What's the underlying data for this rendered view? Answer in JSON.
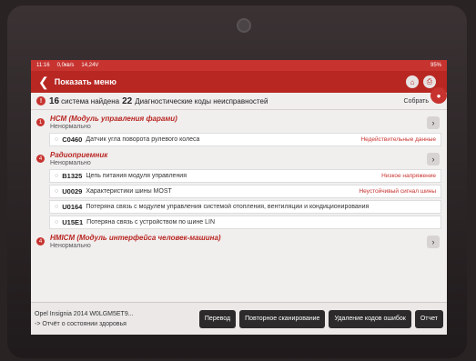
{
  "statusbar": {
    "time": "11:16",
    "speed": "0,0кв/s",
    "voltage": "14,24V",
    "battery": "95%"
  },
  "header": {
    "title": "Показать меню"
  },
  "summary": {
    "systems_count": "16",
    "systems_label": "система найдена",
    "dtc_count": "22",
    "dtc_label": "Диагностические коды неисправностей",
    "collect_label": "Собрать"
  },
  "systems": [
    {
      "badge": "1",
      "name": "HCM (Модуль управления фарами)",
      "status": "Ненормально",
      "codes": [
        {
          "id": "C0460",
          "desc": "Датчик угла поворота рулевого колеса",
          "state": "Недействительные данные"
        }
      ]
    },
    {
      "badge": "4",
      "name": "Радиоприемник",
      "status": "Ненормально",
      "codes": [
        {
          "id": "B1325",
          "desc": "Цепь питания модуля управления",
          "state": "Низкое напряжение"
        },
        {
          "id": "U0029",
          "desc": "Характеристики шины MOST",
          "state": "Неустойчивый сигнал шины"
        },
        {
          "id": "U0164",
          "desc": "Потеряна связь с модулем управления системой отопления, вентиляции и кондиционирования",
          "state": ""
        },
        {
          "id": "U15E1",
          "desc": "Потеряна связь с устройством по шине LIN",
          "state": ""
        }
      ]
    },
    {
      "badge": "4",
      "name": "HMICM (Модуль интерфейса человек-машина)",
      "status": "Ненормально",
      "codes": []
    }
  ],
  "bottom": {
    "vehicle": "Opel  Insignia 2014  W0LGM5ET9...",
    "report_link": "-> Отчёт о состоянии здоровья",
    "btn_translate": "Перевод",
    "btn_rescan": "Повторное сканирование",
    "btn_clear": "Удаление кодов ошибок",
    "btn_report": "Отчет"
  }
}
